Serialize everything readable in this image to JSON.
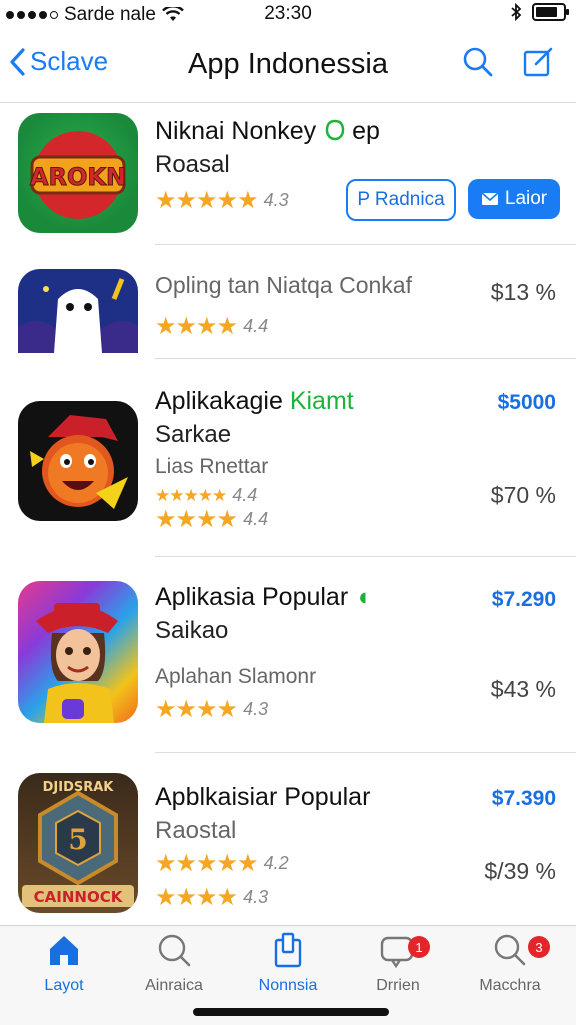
{
  "status": {
    "carrier": "Sarde nale",
    "time": "23:30"
  },
  "nav": {
    "back_label": "Sclave",
    "title": "App Indonessia"
  },
  "apps": [
    {
      "title": "Niknai Nonkey",
      "title_suffix": "ep",
      "subtitle": "Roasal",
      "rating": "4.3",
      "button_outline": "P Radnica",
      "button_fill": "Laior",
      "icon_text": "AROKN"
    },
    {
      "title": "Opling tan Niatqa Conkaf",
      "rating": "4.4",
      "price": "$13 %"
    },
    {
      "title": "Aplikakagie",
      "title_green": "Kiamt",
      "subtitle": "Sarkae",
      "subtitle2": "Lias Rnettar",
      "rating_a": "4.4",
      "rating_b": "4.4",
      "price_blue": "$5000",
      "price": "$70 %"
    },
    {
      "title": "Aplikasia Popular",
      "subtitle": "Saikao",
      "subtitle2": "Aplahan Slamonr",
      "rating": "4.3",
      "price_blue": "$7.290",
      "price": "$43 %"
    },
    {
      "title": "Apblkaisiar Popular",
      "subtitle": "Raostal",
      "rating_a": "4.2",
      "rating_b": "4.3",
      "price_blue": "$7.390",
      "price": "$/39 %",
      "icon_text": "CAINNOCK",
      "icon_top": "DJIDSRAK"
    }
  ],
  "tabs": [
    {
      "label": "Layot"
    },
    {
      "label": "Ainraica"
    },
    {
      "label": "Nonnsia"
    },
    {
      "label": "Drrien",
      "badge": "1"
    },
    {
      "label": "Macchra",
      "badge": "3"
    }
  ],
  "colors": {
    "accent": "#1a7cf5",
    "star": "#f5a623",
    "green": "#1db33a",
    "badge": "#e3262b"
  }
}
